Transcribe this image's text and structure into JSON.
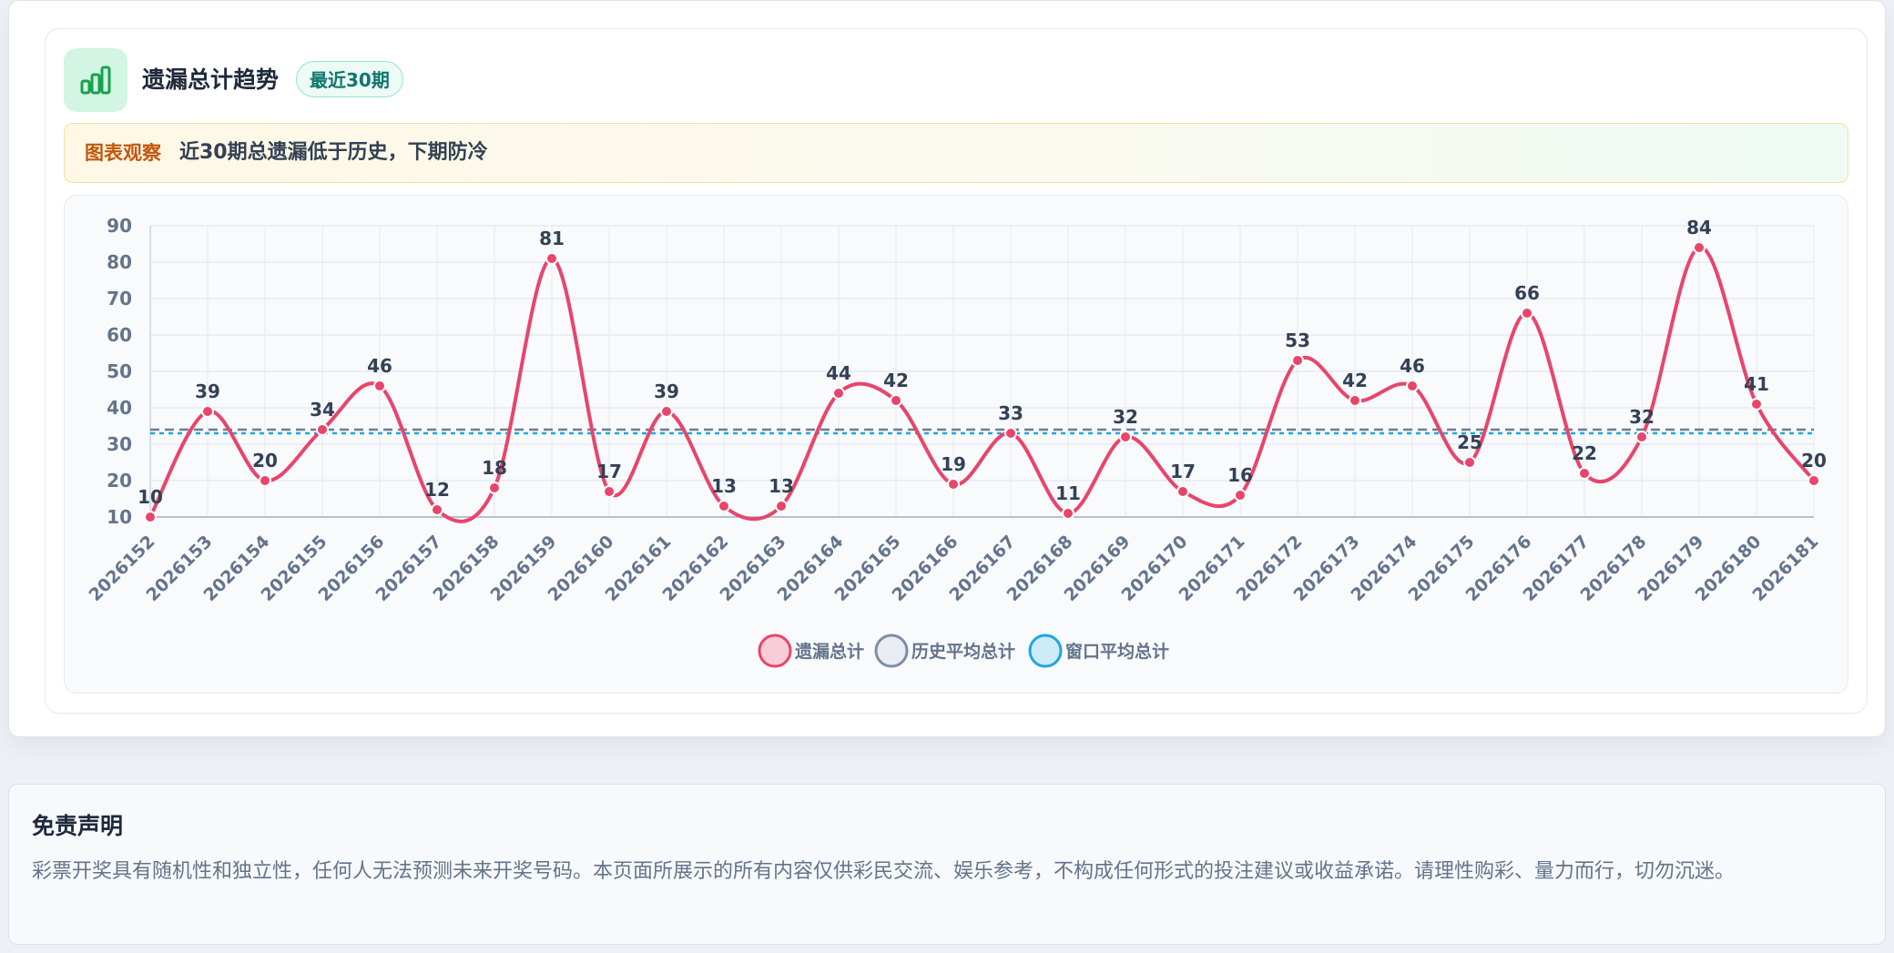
{
  "card": {
    "title": "遗漏总计趋势",
    "badge": "最近30期",
    "icon": "bar-chart-icon",
    "insight_label": "图表观察",
    "insight_text": "近30期总遗漏低于历史，下期防冷"
  },
  "chart_data": {
    "type": "line",
    "categories": [
      "2026152",
      "2026153",
      "2026154",
      "2026155",
      "2026156",
      "2026157",
      "2026158",
      "2026159",
      "2026160",
      "2026161",
      "2026162",
      "2026163",
      "2026164",
      "2026165",
      "2026166",
      "2026167",
      "2026168",
      "2026169",
      "2026170",
      "2026171",
      "2026172",
      "2026173",
      "2026174",
      "2026175",
      "2026176",
      "2026177",
      "2026178",
      "2026179",
      "2026180",
      "2026181"
    ],
    "series": [
      {
        "name": "遗漏总计",
        "values": [
          10,
          39,
          20,
          34,
          46,
          12,
          18,
          81,
          17,
          39,
          13,
          13,
          44,
          42,
          19,
          33,
          11,
          32,
          17,
          16,
          53,
          42,
          46,
          25,
          66,
          22,
          32,
          84,
          41,
          20
        ],
        "color": "#e8456b"
      }
    ],
    "reference_lines": [
      {
        "name": "历史平均总计",
        "value": 34,
        "color": "#6b7d93"
      },
      {
        "name": "窗口平均总计",
        "value": 33,
        "color": "#1ea7e0"
      }
    ],
    "xlabel": "",
    "ylabel": "",
    "ylim": [
      10,
      90
    ],
    "yticks": [
      10,
      20,
      30,
      40,
      50,
      60,
      70,
      80,
      90
    ],
    "grid": true,
    "legend_position": "bottom"
  },
  "disclaimer": {
    "title": "免责声明",
    "text": "彩票开奖具有随机性和独立性，任何人无法预测未来开奖号码。本页面所展示的所有内容仅供彩民交流、娱乐参考，不构成任何形式的投注建议或收益承诺。请理性购彩、量力而行，切勿沉迷。"
  }
}
